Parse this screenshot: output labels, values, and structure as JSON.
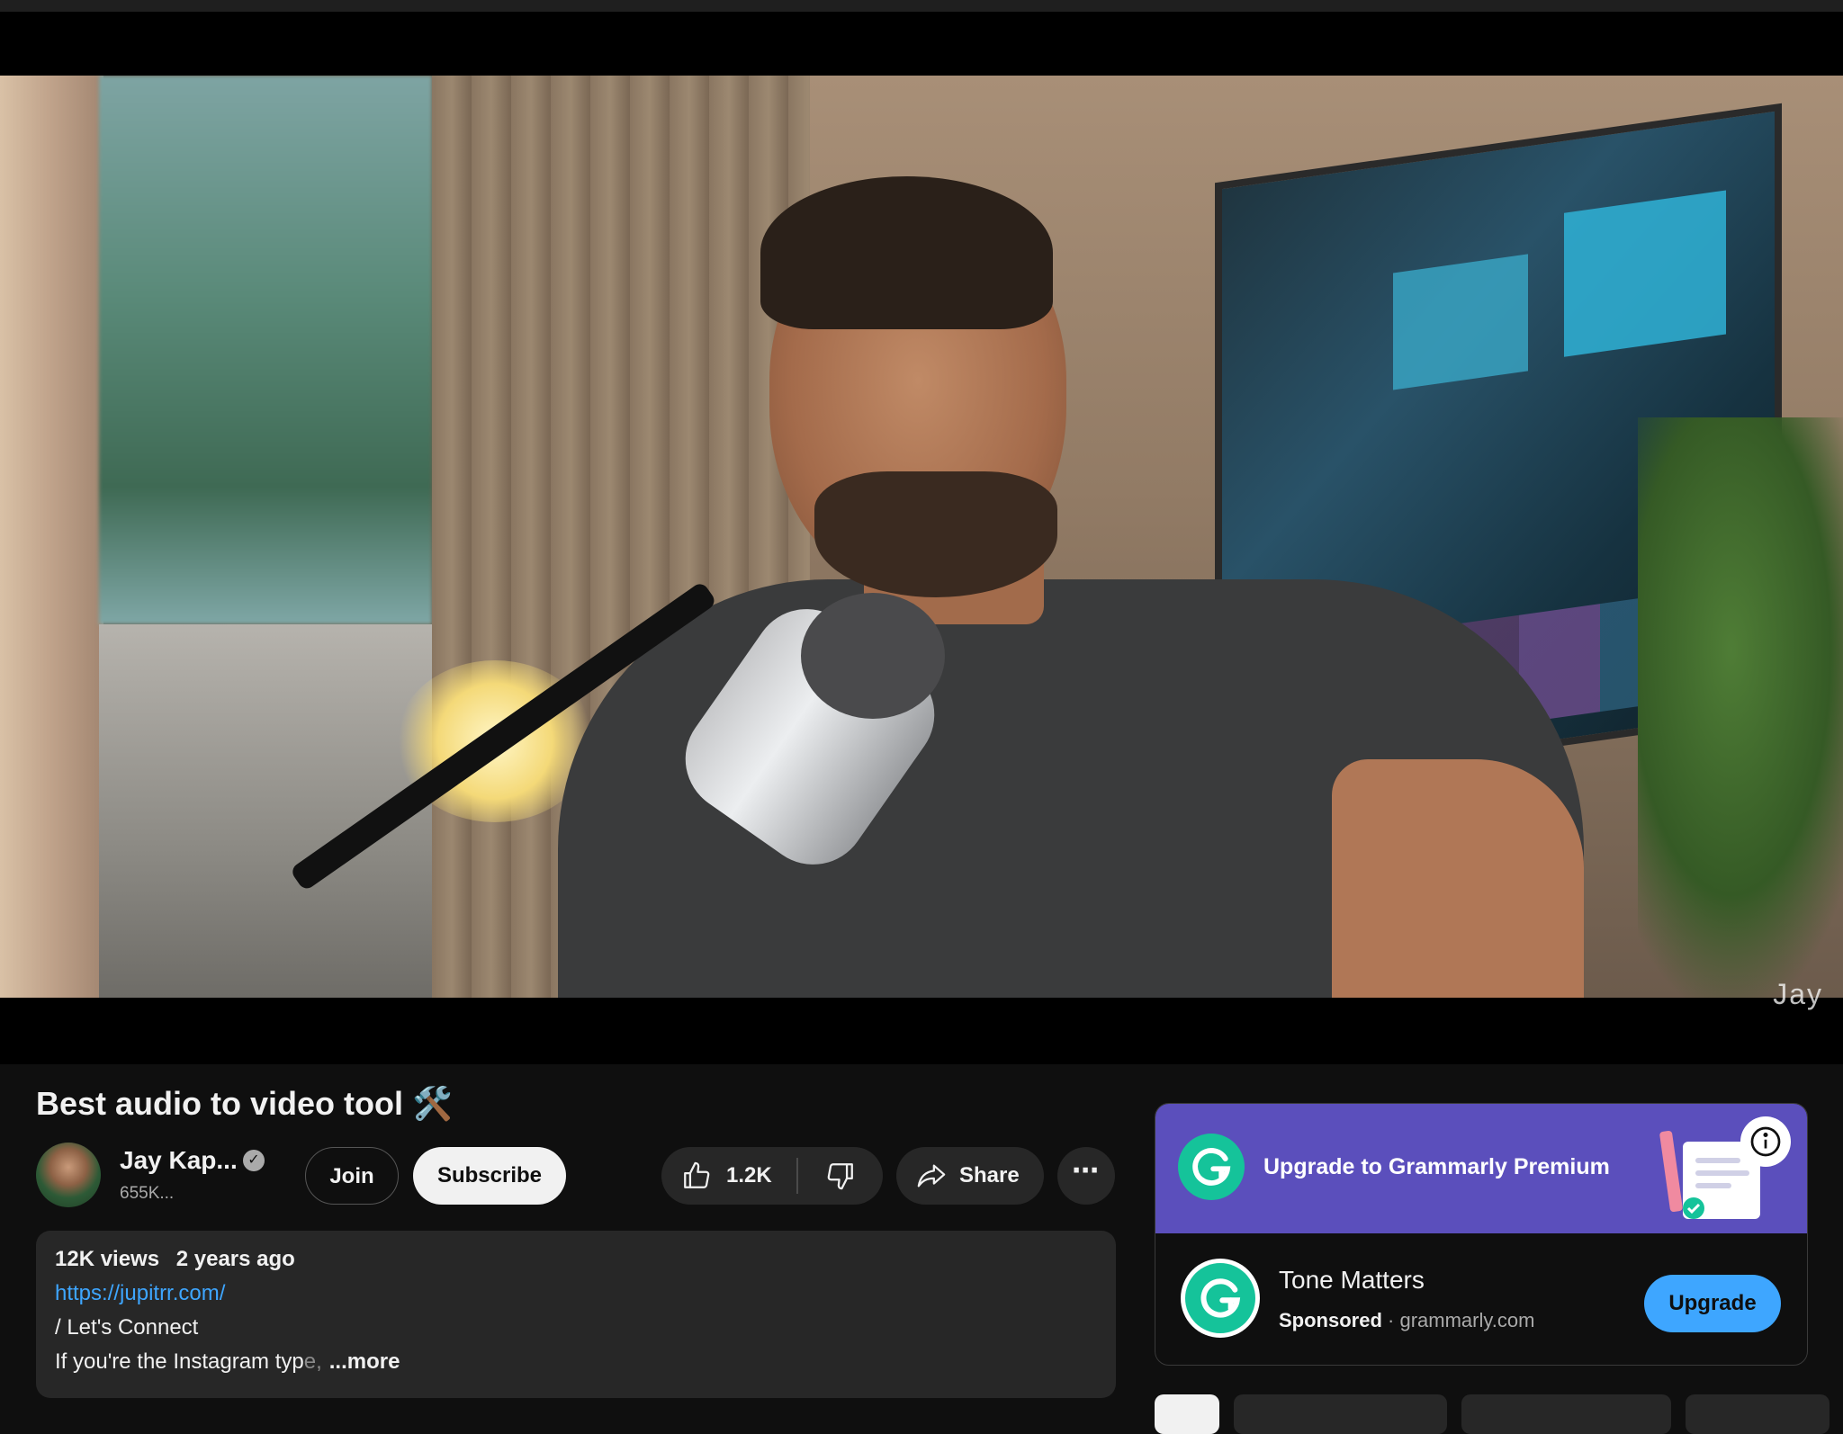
{
  "video": {
    "watermark": "Jay"
  },
  "title": "Best audio to video tool 🛠️",
  "channel": {
    "name": "Jay Kap...",
    "subscribers": "655K...",
    "join_label": "Join",
    "subscribe_label": "Subscribe"
  },
  "actions": {
    "like_count": "1.2K",
    "share_label": "Share",
    "more_label": "⋯"
  },
  "description": {
    "views": "12K views",
    "age": "2 years ago",
    "link": "https://jupitrr.com/",
    "line2": "/ Let's Connect",
    "line3_main": "If you're the Instagram typ",
    "line3_fade": "e,",
    "more": "...more"
  },
  "ad": {
    "banner_text": "Upgrade to Grammarly Premium",
    "headline": "Tone Matters",
    "sponsored": "Sponsored",
    "separator": "·",
    "domain": "grammarly.com",
    "cta": "Upgrade",
    "info_icon": "i",
    "brand_color": "#15c39a",
    "banner_color": "#5b4fbc",
    "cta_color": "#3ea6ff"
  }
}
